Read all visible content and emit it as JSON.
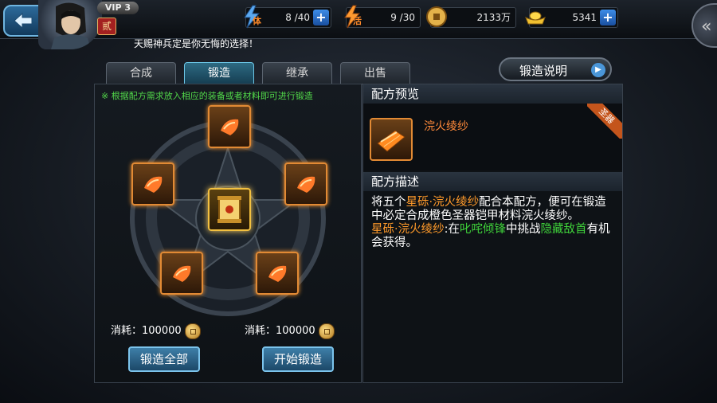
{
  "header": {
    "vip": "VIP 3",
    "rank_badge": "贰",
    "motto": "天赐神兵定是你无悔的选择！",
    "stamina": {
      "icon_label": "体",
      "value": "8 /40",
      "plus": "+"
    },
    "vitality": {
      "icon_label": "活",
      "value": "9 /30"
    },
    "coins": {
      "value": "2133万"
    },
    "gold": {
      "value": "5341",
      "plus": "+"
    },
    "side_button": "«"
  },
  "tabs": [
    {
      "label": "合成"
    },
    {
      "label": "锻造",
      "active": true
    },
    {
      "label": "继承"
    },
    {
      "label": "出售"
    }
  ],
  "help_button": {
    "label": "锻造说明",
    "arrow": "▶"
  },
  "left_panel": {
    "hint": "※ 根据配方需求放入相应的装备或者材料即可进行锻造",
    "cost_left": "消耗：100000",
    "cost_right": "消耗：100000",
    "btn_forge_all": "锻造全部",
    "btn_start_forge": "开始锻造"
  },
  "right_panel": {
    "preview_title": "配方预览",
    "item_name": "浣火绫纱",
    "corner_badge": "圣器",
    "desc_title": "配方描述",
    "desc": {
      "p1_a": "将五个",
      "p1_item": "星砾·浣火绫纱",
      "p1_b": "配合本配方，便可在锻造中必定合成橙色圣器铠甲材料浣火绫纱。",
      "p2_item": "星砾·浣火绫纱",
      "p2_a": ":在",
      "p2_place": "叱咤倾锋",
      "p2_b": "中挑战",
      "p2_boss": "隐藏敌首",
      "p2_c": "有机会获得。"
    }
  },
  "colors": {
    "accent_orange": "#ff9a2a",
    "accent_green": "#3fd23a",
    "tab_active": "#2d6a82"
  }
}
